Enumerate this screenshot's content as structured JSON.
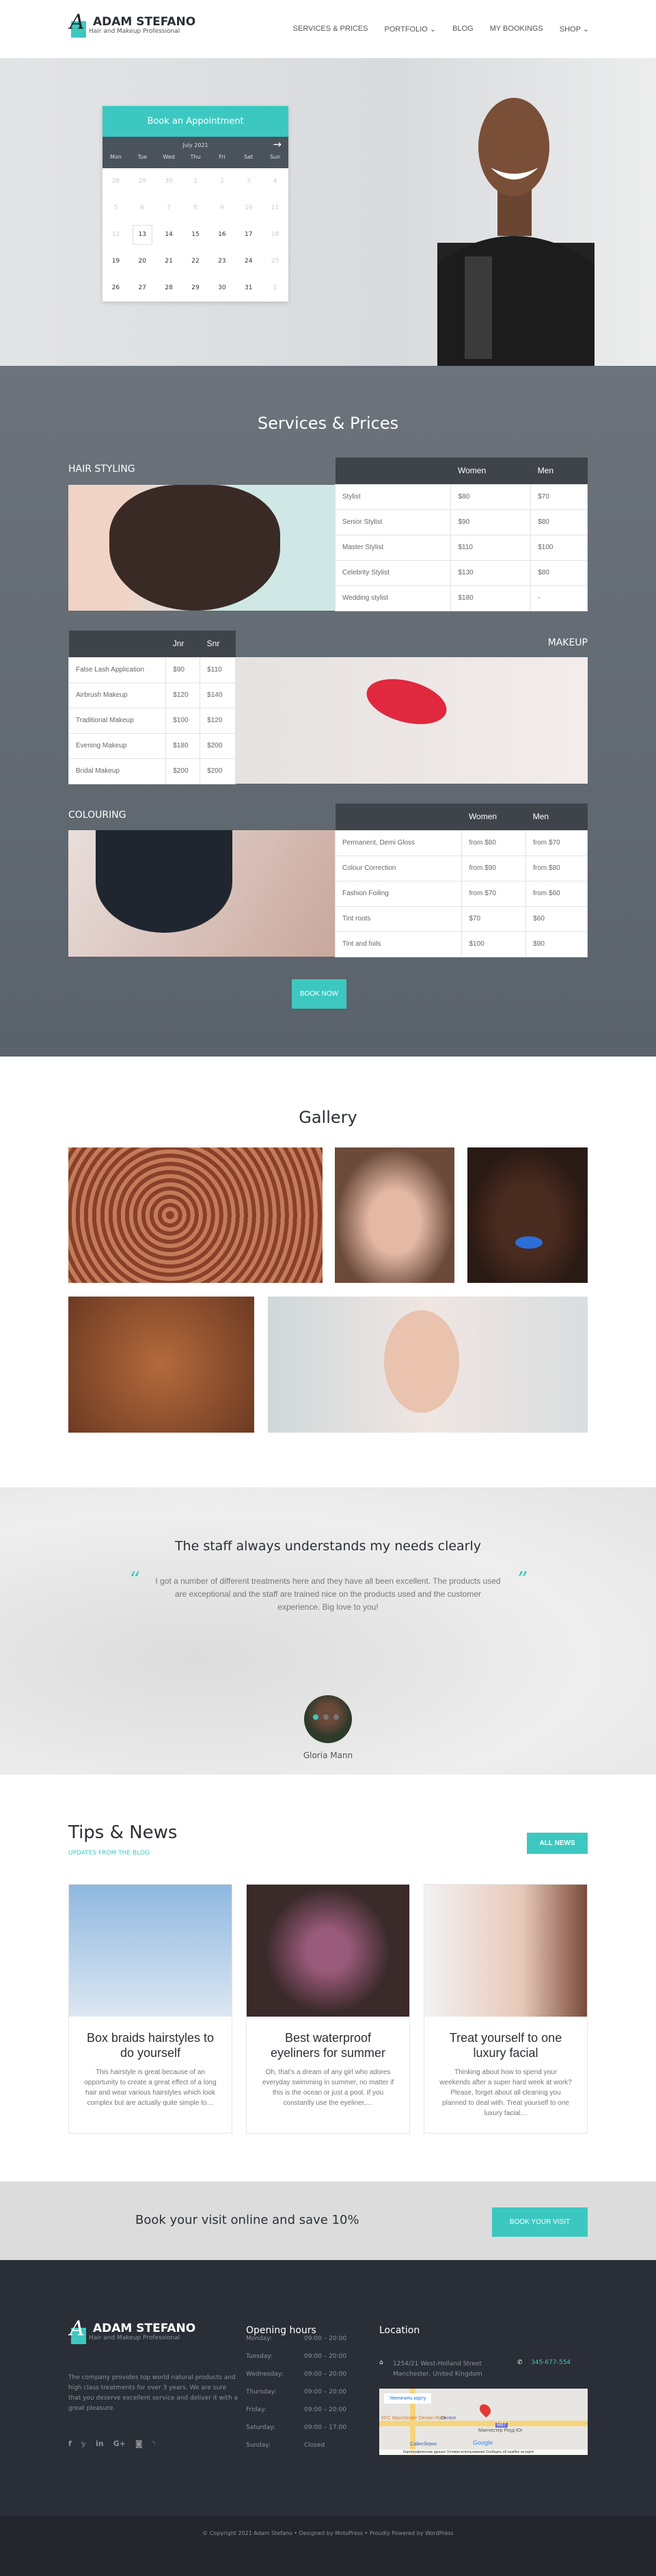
{
  "brand": {
    "name": "ADAM STEFANO",
    "tagline": "Hair and Makeup Professional",
    "logo_letters": "AS",
    "accent": "#3cc8c0"
  },
  "nav": [
    "SERVICES & PRICES",
    "PORTFOLIO ⌄",
    "BLOG",
    "MY BOOKINGS",
    "SHOP ⌄"
  ],
  "calendar": {
    "title": "Book an Appointment",
    "month": "July 2021",
    "next_icon": "arrow-right-icon",
    "days": [
      "Mon",
      "Tue",
      "Wed",
      "Thu",
      "Fri",
      "Sat",
      "Sun"
    ],
    "weeks": [
      [
        "28",
        "29",
        "30",
        "1",
        "2",
        "3",
        "4"
      ],
      [
        "5",
        "6",
        "7",
        "8",
        "9",
        "10",
        "11"
      ],
      [
        "12",
        "13",
        "14",
        "15",
        "16",
        "17",
        "18"
      ],
      [
        "19",
        "20",
        "21",
        "22",
        "23",
        "24",
        "25"
      ],
      [
        "26",
        "27",
        "28",
        "29",
        "30",
        "31",
        "1"
      ]
    ],
    "selected": "13"
  },
  "services": {
    "title": "Services & Prices",
    "book_now": "BOOK NOW",
    "hair": {
      "label": "HAIR STYLING",
      "cols": [
        "",
        "Women",
        "Men"
      ],
      "rows": [
        [
          "Stylist",
          "$80",
          "$70"
        ],
        [
          "Senior Stylist",
          "$90",
          "$80"
        ],
        [
          "Master Stylist",
          "$110",
          "$100"
        ],
        [
          "Celebrity Stylist",
          "$130",
          "$80"
        ],
        [
          "Wedding stylist",
          "$180",
          "-"
        ]
      ]
    },
    "makeup": {
      "label": "MAKEUP",
      "cols": [
        "",
        "Jnr",
        "Snr"
      ],
      "rows": [
        [
          "False Lash Application",
          "$90",
          "$110"
        ],
        [
          "Airbrush Makeup",
          "$120",
          "$140"
        ],
        [
          "Traditional Makeup",
          "$100",
          "$120"
        ],
        [
          "Evening Makeup",
          "$180",
          "$200"
        ],
        [
          "Bridal Makeup",
          "$200",
          "$200"
        ]
      ]
    },
    "colouring": {
      "label": "COLOURING",
      "cols": [
        "",
        "Women",
        "Men"
      ],
      "rows": [
        [
          "Permanent, Demi Gloss",
          "from $80",
          "from $70"
        ],
        [
          "Colour Correction",
          "from $90",
          "from $80"
        ],
        [
          "Fashion Foiling",
          "from $70",
          "from $60"
        ],
        [
          "Tint roots",
          "$70",
          "$60"
        ],
        [
          "Tint and foils",
          "$100",
          "$90"
        ]
      ]
    }
  },
  "gallery": {
    "title": "Gallery"
  },
  "testimonial": {
    "title": "The staff always understands my needs clearly",
    "quote": "I got a number of different treatments here and they have all been excellent. The products used are exceptional and the staff are trained nice on the products used and the customer experience. Big love to you!",
    "author": "Gloria Mann",
    "open_quote": "“",
    "close_quote": "”",
    "slides": 3,
    "active_slide": 1
  },
  "tips": {
    "title": "Tips & News",
    "subtitle": "UPDATES FROM THE BLOG",
    "all_news": "ALL NEWS",
    "posts": [
      {
        "title": "Box braids hairstyles to do yourself",
        "excerpt": "This hairstyle is great because of an opportunity to create a great effect of a long hair and wear various hairstyles which look complex but are actually quite simple to…"
      },
      {
        "title": "Best waterproof eyeliners for summer",
        "excerpt": "Oh, that’s a dream of any girl who adores everyday swimming in summer, no matter if this is the ocean or just a pool. If you constantly use the eyeliner,…"
      },
      {
        "title": "Treat yourself to one luxury facial",
        "excerpt": "Thinking about how to spend your weekends after a super hard week at work? Please, forget about all cleaning you planned to deal with. Treat yourself to one luxury facial…"
      }
    ]
  },
  "cta": {
    "text": "Book your visit online and save 10%",
    "button": "BOOK YOUR VISIT"
  },
  "footer": {
    "about": "The company provides top world natural products and high class treatments for over 3 years. We are sure that you deserve excellent service and deliver it with a great pleasure.",
    "social": [
      "f",
      "𝕪",
      "in",
      "G+",
      "◙",
      "◝"
    ],
    "hours_title": "Opening hours",
    "hours": [
      [
        "Monday:",
        "09:00 – 20:00"
      ],
      [
        "Tuesday:",
        "09:00 – 20:00"
      ],
      [
        "Wednesday:",
        "09:00 – 20:00"
      ],
      [
        "Thursday:",
        "09:00 – 20:00"
      ],
      [
        "Friday:",
        "09:00 – 20:00"
      ],
      [
        "Saturday:",
        "09:00 – 17:00"
      ],
      [
        "Sunday:",
        "Closed"
      ]
    ],
    "location_title": "Location",
    "address1": "1254/21 West-Holland Street",
    "address2": "Manchester, United Kingdom",
    "phone": "345-677-554",
    "map": {
      "enlarge": "Увеличить карту",
      "labels": [
        "KFC Manchester Denton Rock",
        "Denton",
        "Манчестер Роуд Юг",
        "Сайнсберис",
        "M67",
        "Google"
      ],
      "footer": "Картографические данные   Условия использования   Сообщить об ошибке на карте"
    },
    "copyright": "© Copyright 2021 Adam Stefano • Designed by MotoPress • Proudly Powered by WordPress"
  }
}
